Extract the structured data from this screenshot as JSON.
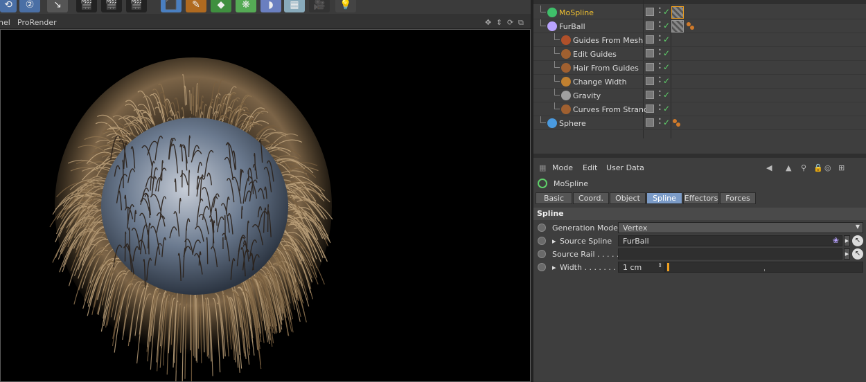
{
  "viewport": {
    "menu": [
      "nel",
      "ProRender"
    ]
  },
  "object_manager": {
    "rows": [
      {
        "name": "MoSpline",
        "highlight": true
      },
      {
        "name": "FurBall",
        "highlight": false
      },
      {
        "name": "Guides From Mesh",
        "highlight": false
      },
      {
        "name": "Edit Guides",
        "highlight": false
      },
      {
        "name": "Hair From Guides",
        "highlight": false
      },
      {
        "name": "Change Width",
        "highlight": false
      },
      {
        "name": "Gravity",
        "highlight": false
      },
      {
        "name": "Curves From Strands",
        "highlight": false
      },
      {
        "name": "Sphere",
        "highlight": false
      }
    ]
  },
  "attribute_manager": {
    "menu": [
      "Mode",
      "Edit",
      "User Data"
    ],
    "object_name": "MoSpline",
    "tabs": [
      "Basic",
      "Coord.",
      "Object",
      "Spline",
      "Effectors",
      "Forces"
    ],
    "active_tab": "Spline",
    "section": "Spline",
    "params": {
      "generation_mode_label": "Generation Mode",
      "generation_mode_value": "Vertex",
      "source_spline_label": "Source Spline",
      "source_spline_value": "FurBall",
      "source_rail_label": "Source Rail . . . . .",
      "source_rail_value": "",
      "width_label": "Width . . . . . . . .",
      "width_value": "1 cm"
    }
  },
  "colors": {
    "highlight_text": "#f0c030",
    "active_tab": "#7b9bc7",
    "check": "#5fd16a"
  }
}
